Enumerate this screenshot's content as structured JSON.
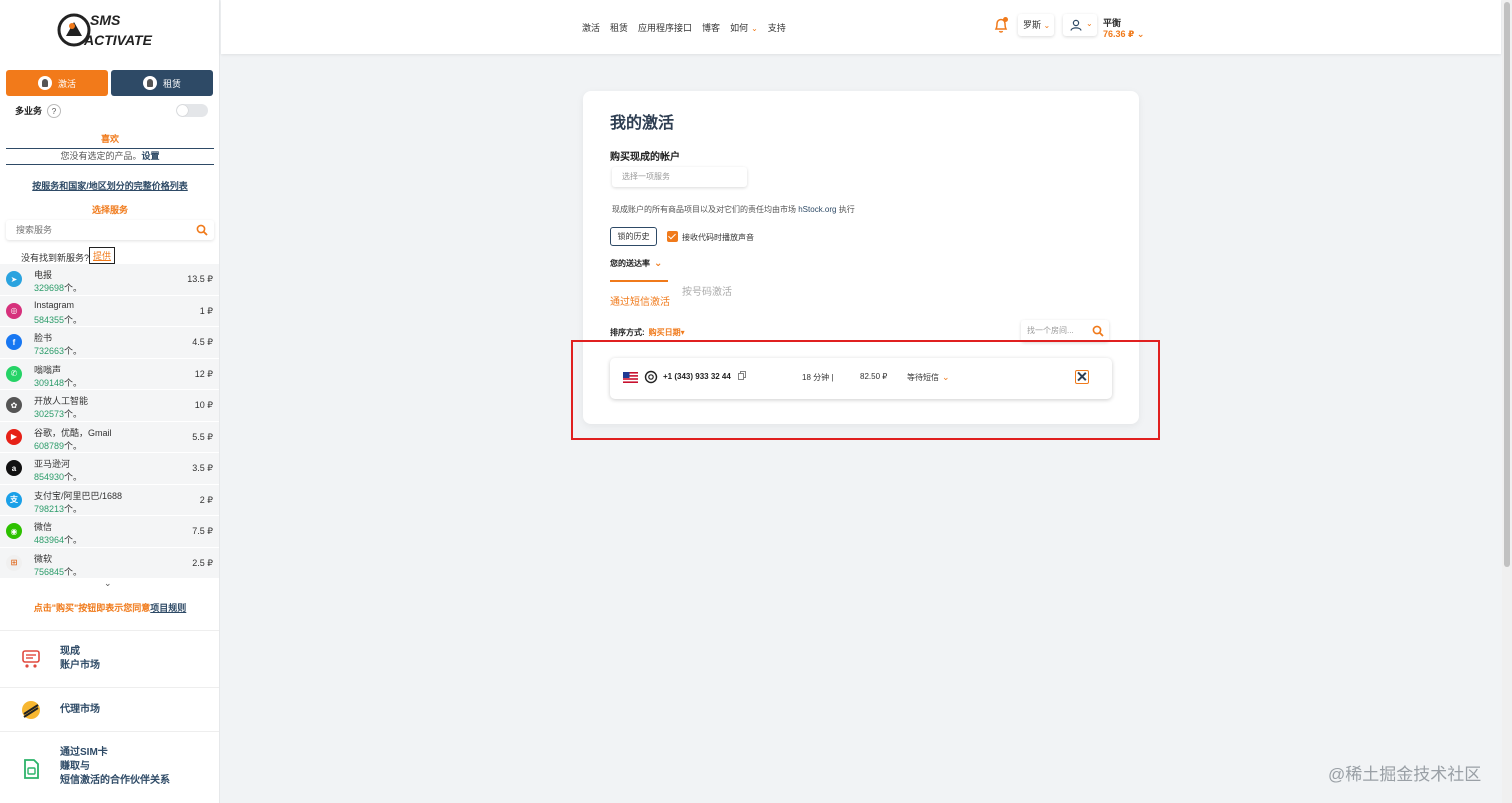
{
  "logo": {
    "line1": "SMS",
    "line2": "ACTIVATE"
  },
  "sidebar": {
    "mode_activate": "激活",
    "mode_rent": "租赁",
    "multi_service": "多业务",
    "help": "?",
    "favorites_title": "喜欢",
    "favorites_empty": "您没有选定的产品。",
    "favorites_setup": "设置",
    "price_list_link": "按服务和国家/地区划分的完整价格列表",
    "select_service": "选择服务",
    "search_placeholder": "搜索服务",
    "not_found": "没有找到新服务?",
    "offer": "提供",
    "services": [
      {
        "name": "电报",
        "count": "329698",
        "unit": "个。",
        "price": "13.5 ₽",
        "icon": "telegram-icon",
        "color": "#2aa3df",
        "glyph": "➤"
      },
      {
        "name": "Instagram",
        "count": "584355",
        "unit": "个。",
        "price": "1 ₽",
        "icon": "instagram-icon",
        "color": "#d6317c",
        "glyph": "◎"
      },
      {
        "name": "脸书",
        "count": "732663",
        "unit": "个。",
        "price": "4.5 ₽",
        "icon": "facebook-icon",
        "color": "#1877f2",
        "glyph": "f"
      },
      {
        "name": "嗡嗡声",
        "count": "309148",
        "unit": "个。",
        "price": "12 ₽",
        "icon": "whatsapp-icon",
        "color": "#25d366",
        "glyph": "✆"
      },
      {
        "name": "开放人工智能",
        "count": "302573",
        "unit": "个。",
        "price": "10 ₽",
        "icon": "openai-icon",
        "color": "#555555",
        "glyph": "✿"
      },
      {
        "name": "谷歌，优酷，Gmail",
        "count": "608789",
        "unit": "个。",
        "price": "5.5 ₽",
        "icon": "youtube-icon",
        "color": "#e62117",
        "glyph": "▶"
      },
      {
        "name": "亚马逊河",
        "count": "854930",
        "unit": "个。",
        "price": "3.5 ₽",
        "icon": "amazon-icon",
        "color": "#111111",
        "glyph": "a"
      },
      {
        "name": "支付宝/阿里巴巴/1688",
        "count": "798213",
        "unit": "个。",
        "price": "2 ₽",
        "icon": "alipay-icon",
        "color": "#1aa0e8",
        "glyph": "支"
      },
      {
        "name": "微信",
        "count": "483964",
        "unit": "个。",
        "price": "7.5 ₽",
        "icon": "wechat-icon",
        "color": "#2dc100",
        "glyph": "◉"
      },
      {
        "name": "微软",
        "count": "756845",
        "unit": "个。",
        "price": "2.5 ₽",
        "icon": "microsoft-icon",
        "color": "#f0f0f0",
        "glyph": "⊞"
      }
    ],
    "more": "⌄",
    "rules_text": "点击\"购买\"按钮即表示您同意",
    "rules_link": "项目规则",
    "promo_market_1": "现成",
    "promo_market_2": "账户市场",
    "promo_proxy": "代理市场",
    "promo_sim_1": "通过SIM卡",
    "promo_sim_2": "赚取与",
    "promo_sim_3": "短信激活的合作伙伴关系"
  },
  "topbar": {
    "nav": [
      "激活",
      "租赁",
      "应用程序接口",
      "博客",
      "如何",
      "支持"
    ],
    "nav_arrow": "⌄",
    "language": "罗斯",
    "balance_label": "平衡",
    "balance_value": "76.36 ₽",
    "dropdown_arrow": "⌄"
  },
  "main": {
    "title": "我的激活",
    "buy_accounts": "购买现成的帐户",
    "service_placeholder": "选择一项服务",
    "disclaimer_pre": "现成账户的所有商品项目以及对它们的责任均由市场",
    "disclaimer_link": "hStock.org",
    "disclaimer_post": "执行",
    "lock_history": "锁的历史",
    "sound_label": "接收代码时播放声音",
    "delivery_rate": "您的送达率",
    "tab_sms": "通过短信激活",
    "tab_number": "按号码激活",
    "sort_label": "排序方式:",
    "sort_value": "购买日期▾",
    "room_search_placeholder": "找一个房间...",
    "activation": {
      "phone": "+1 (343) 933 32 44",
      "time": "18 分钟 |",
      "price": "82.50 ₽",
      "status": "等待短信"
    }
  },
  "watermark": "@稀土掘金技术社区"
}
